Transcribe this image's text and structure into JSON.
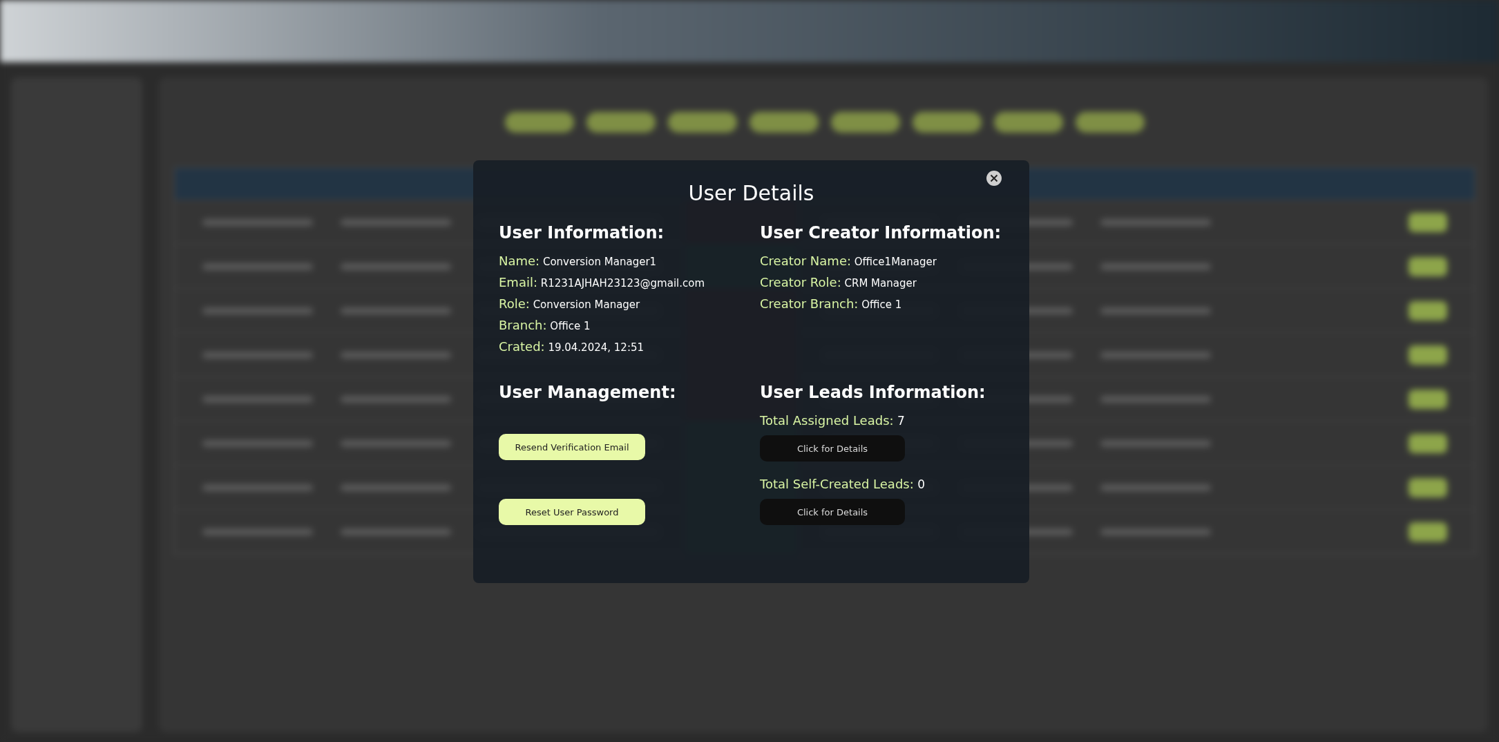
{
  "modal": {
    "title": "User Details",
    "user_information": {
      "heading": "User Information:",
      "fields": [
        {
          "label": "Name:",
          "value": "Conversion Manager1"
        },
        {
          "label": "Email:",
          "value": "R1231AJHAH23123@gmail.com"
        },
        {
          "label": "Role:",
          "value": "Conversion Manager"
        },
        {
          "label": "Branch:",
          "value": "Office 1"
        },
        {
          "label": "Crated:",
          "value": "19.04.2024, 12:51"
        }
      ]
    },
    "creator_information": {
      "heading": "User Creator Information:",
      "fields": [
        {
          "label": "Creator Name:",
          "value": "Office1Manager"
        },
        {
          "label": "Creator Role:",
          "value": "CRM Manager"
        },
        {
          "label": "Creator Branch:",
          "value": "Office 1"
        }
      ]
    },
    "user_management": {
      "heading": "User Management:",
      "buttons": [
        "Resend Verification Email",
        "Reset User Password"
      ]
    },
    "leads_information": {
      "heading": "User Leads Information:",
      "items": [
        {
          "label": "Total Assigned Leads:",
          "value": "7",
          "button": "Click for Details"
        },
        {
          "label": "Total Self-Created Leads:",
          "value": "0",
          "button": "Click for Details"
        }
      ]
    }
  }
}
